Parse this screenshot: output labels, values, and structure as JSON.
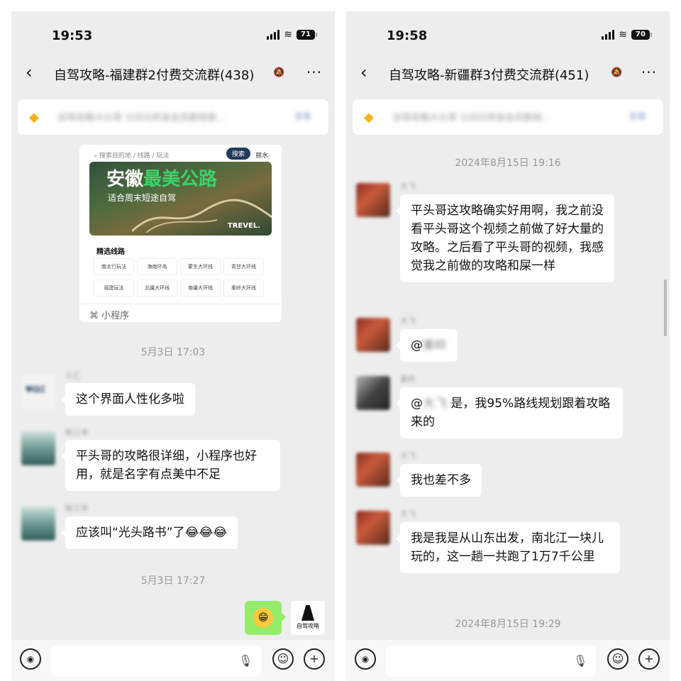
{
  "left": {
    "status": {
      "time": "19:53",
      "battery": "71"
    },
    "nav": {
      "back": "‹",
      "title": "自驾攻略-福建群2付费交流群(438)",
      "mute": "🔕",
      "more": "···"
    },
    "notice": {
      "text": "自驾攻略大头哥 328元终身会员群规章...",
      "tag": "查看"
    },
    "mini_program": {
      "search_placeholder": "⌕ 搜索目的地 / 线路 / 玩法",
      "search_button": "搜索",
      "search_more": "丽水·",
      "banner_title_1": "安徽",
      "banner_title_2": "最美公路",
      "banner_subtitle": "适合周末短途自驾",
      "banner_brand": "TREVEL.",
      "section_title": "精选线路",
      "routes": [
        "南太行玩法",
        "海南环岛",
        "蒙东大环线",
        "青甘大环线",
        "福建玩法",
        "北疆大环线",
        "南疆大环线",
        "秦岭大环线"
      ],
      "footer_label": "小程序",
      "footer_icon": "⌘"
    },
    "messages": [
      {
        "time": "5月3日 17:03"
      },
      {
        "sender": "小乙",
        "text": "这个界面人性化多啦"
      },
      {
        "sender": "帐三丰",
        "text": "平头哥的攻略很详细，小程序也好用，就是名字有点美中不足"
      },
      {
        "sender": "帐三丰",
        "text": "应该叫“光头路书”了",
        "emoji": "😂😂😂"
      },
      {
        "time": "5月3日 17:27"
      }
    ],
    "self_sticker": "😁",
    "self_label": "自驾攻略"
  },
  "right": {
    "status": {
      "time": "19:58",
      "battery": "70"
    },
    "nav": {
      "back": "‹",
      "title": "自驾攻略-新疆群3付费交流群(451)",
      "mute": "🔕",
      "more": "···"
    },
    "notice": {
      "text": "自驾攻略大头哥 328元终身会员群规...",
      "tag": "查看"
    },
    "messages": [
      {
        "time": "2024年8月15日 19:16"
      },
      {
        "sender": "大飞",
        "text": "平头哥这攻略确实好用啊，我之前没看平头哥这个视频之前做了好大量的攻略。之后看了平头哥的视频，我感觉我之前做的攻略和屎一样"
      },
      {
        "sender": "大飞",
        "mention": "@",
        "mention_name": "秦岭"
      },
      {
        "sender": "秦岭",
        "mention": "@",
        "mention_name": "大飞",
        "text": "是，我95%路线规划跟着攻略来的"
      },
      {
        "sender": "大飞",
        "text": "我也差不多"
      },
      {
        "sender": "大飞",
        "text": "我是我是从山东出发，南北江一块儿玩的，这一趟一共跑了1万7千公里"
      },
      {
        "time": "2024年8月15日 19:29"
      }
    ]
  },
  "input": {
    "voice_icon": "◉",
    "mic_icon": "🎙",
    "emoji_icon": "☺",
    "plus_icon": "+"
  },
  "colors": {
    "background": "#ededed",
    "bubble_self": "#95ec69",
    "bubble_other": "#ffffff",
    "accent": "#1f3a5b"
  }
}
